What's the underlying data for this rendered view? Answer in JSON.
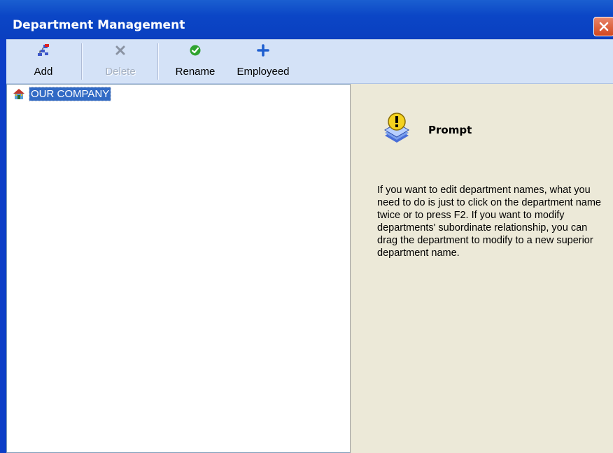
{
  "window": {
    "title": "Department Management"
  },
  "toolbar": {
    "buttons": [
      {
        "label": "Add",
        "icon": "add-department-icon",
        "enabled": true
      },
      {
        "label": "Delete",
        "icon": "delete-x-icon",
        "enabled": false
      },
      {
        "label": "Rename",
        "icon": "green-check-icon",
        "enabled": true
      },
      {
        "label": "Employeed",
        "icon": "blue-plus-icon",
        "enabled": true
      }
    ]
  },
  "tree": {
    "root": {
      "label": "OUR COMPANY",
      "icon": "home-icon",
      "selected": true
    }
  },
  "prompt": {
    "title": "Prompt",
    "icon": "info-bulb-icon",
    "text": "If you want to edit department names, what you need to do is just to click on the department name twice or to press F2. If you want to modify departments' subordinate relationship, you can drag the department to modify to a new superior department name."
  },
  "colors": {
    "titlebar": "#0b46c6",
    "toolbar": "#d4e2f7",
    "selection": "#316ac5",
    "panel": "#ece9d8",
    "close": "#d3481f"
  }
}
